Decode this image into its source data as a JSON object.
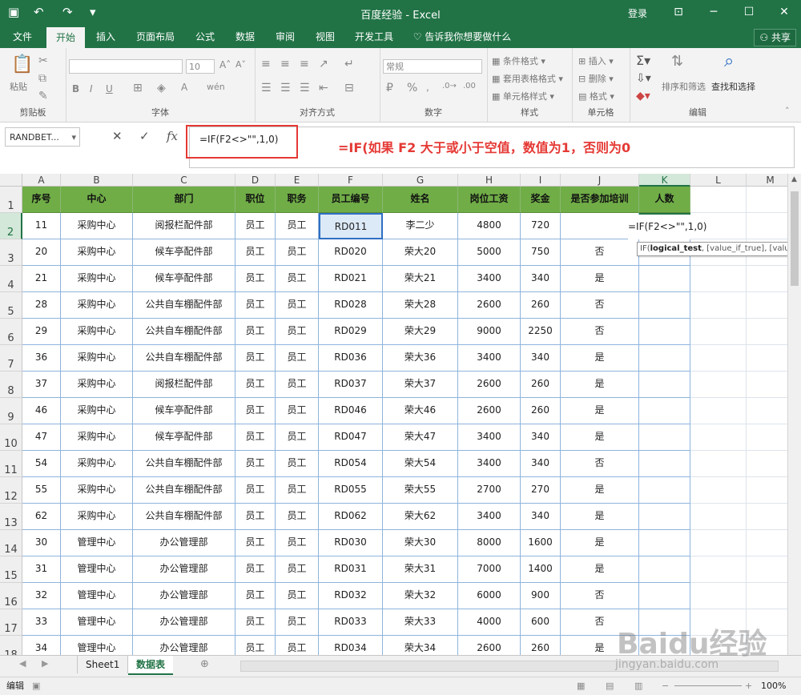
{
  "window": {
    "title": "百度经验  -  Excel",
    "login": "登录"
  },
  "tabs": [
    "文件",
    "开始",
    "插入",
    "页面布局",
    "公式",
    "数据",
    "审阅",
    "视图",
    "开发工具"
  ],
  "tell_me": "告诉我你想要做什么",
  "share": "共享",
  "ribbon": {
    "clipboard": {
      "label": "剪贴板",
      "paste": "粘贴"
    },
    "font": {
      "label": "字体",
      "size": "10"
    },
    "align": {
      "label": "对齐方式"
    },
    "number": {
      "label": "数字",
      "format": "常规"
    },
    "styles": {
      "label": "样式",
      "cond": "条件格式",
      "table": "套用表格格式",
      "cell": "单元格样式"
    },
    "cells": {
      "label": "单元格",
      "insert": "插入",
      "delete": "删除",
      "format": "格式"
    },
    "editing": {
      "label": "编辑",
      "sort": "排序和筛选",
      "find": "查找和选择"
    }
  },
  "formula_bar": {
    "name_box": "RANDBET...",
    "formula": "=IF(F2<>\"\",1,0)",
    "annotation": "=IF(如果 F2 大于或小于空值，数值为1，否则为0"
  },
  "columns": [
    "A",
    "B",
    "C",
    "D",
    "E",
    "F",
    "G",
    "H",
    "I",
    "J",
    "K",
    "L",
    "M"
  ],
  "headers": [
    "序号",
    "中心",
    "部门",
    "职位",
    "职务",
    "员工编号",
    "姓名",
    "岗位工资",
    "奖金",
    "是否参加培训",
    "人数"
  ],
  "rows": [
    [
      "11",
      "采购中心",
      "阅报栏配件部",
      "员工",
      "员工",
      "RD011",
      "李二少",
      "4800",
      "720",
      "",
      ""
    ],
    [
      "20",
      "采购中心",
      "候车亭配件部",
      "员工",
      "员工",
      "RD020",
      "荣大20",
      "5000",
      "750",
      "否",
      ""
    ],
    [
      "21",
      "采购中心",
      "候车亭配件部",
      "员工",
      "员工",
      "RD021",
      "荣大21",
      "3400",
      "340",
      "是",
      ""
    ],
    [
      "28",
      "采购中心",
      "公共自车棚配件部",
      "员工",
      "员工",
      "RD028",
      "荣大28",
      "2600",
      "260",
      "否",
      ""
    ],
    [
      "29",
      "采购中心",
      "公共自车棚配件部",
      "员工",
      "员工",
      "RD029",
      "荣大29",
      "9000",
      "2250",
      "否",
      ""
    ],
    [
      "36",
      "采购中心",
      "公共自车棚配件部",
      "员工",
      "员工",
      "RD036",
      "荣大36",
      "3400",
      "340",
      "是",
      ""
    ],
    [
      "37",
      "采购中心",
      "阅报栏配件部",
      "员工",
      "员工",
      "RD037",
      "荣大37",
      "2600",
      "260",
      "是",
      ""
    ],
    [
      "46",
      "采购中心",
      "候车亭配件部",
      "员工",
      "员工",
      "RD046",
      "荣大46",
      "2600",
      "260",
      "是",
      ""
    ],
    [
      "47",
      "采购中心",
      "候车亭配件部",
      "员工",
      "员工",
      "RD047",
      "荣大47",
      "3400",
      "340",
      "是",
      ""
    ],
    [
      "54",
      "采购中心",
      "公共自车棚配件部",
      "员工",
      "员工",
      "RD054",
      "荣大54",
      "3400",
      "340",
      "否",
      ""
    ],
    [
      "55",
      "采购中心",
      "公共自车棚配件部",
      "员工",
      "员工",
      "RD055",
      "荣大55",
      "2700",
      "270",
      "是",
      ""
    ],
    [
      "62",
      "采购中心",
      "公共自车棚配件部",
      "员工",
      "员工",
      "RD062",
      "荣大62",
      "3400",
      "340",
      "是",
      ""
    ],
    [
      "30",
      "管理中心",
      "办公管理部",
      "员工",
      "员工",
      "RD030",
      "荣大30",
      "8000",
      "1600",
      "是",
      ""
    ],
    [
      "31",
      "管理中心",
      "办公管理部",
      "员工",
      "员工",
      "RD031",
      "荣大31",
      "7000",
      "1400",
      "是",
      ""
    ],
    [
      "32",
      "管理中心",
      "办公管理部",
      "员工",
      "员工",
      "RD032",
      "荣大32",
      "6000",
      "900",
      "否",
      ""
    ],
    [
      "33",
      "管理中心",
      "办公管理部",
      "员工",
      "员工",
      "RD033",
      "荣大33",
      "4000",
      "600",
      "否",
      ""
    ],
    [
      "34",
      "管理中心",
      "办公管理部",
      "员工",
      "员工",
      "RD034",
      "荣大34",
      "2600",
      "260",
      "是",
      ""
    ]
  ],
  "edit_cell_text": "=IF(F2<>\"\",1,0)",
  "tooltip": {
    "func": "IF(",
    "arg1": "logical_test",
    "rest": ", [value_if_true], [value_"
  },
  "sheets": [
    "Sheet1",
    "数据表"
  ],
  "status": {
    "mode": "编辑",
    "zoom": "100%"
  },
  "watermark": {
    "main": "Baidu经验",
    "sub": "jingyan.baidu.com"
  }
}
